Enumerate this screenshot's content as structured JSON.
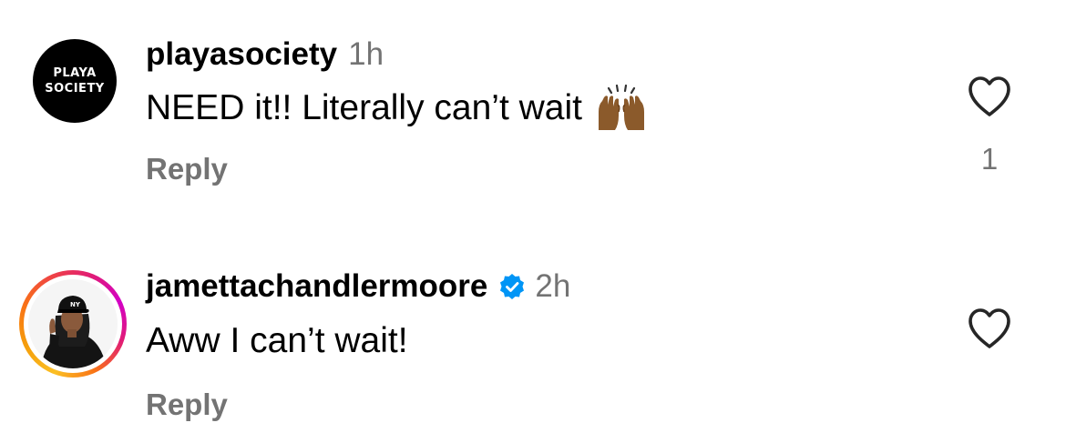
{
  "comments": [
    {
      "username": "playasociety",
      "timestamp": "1h",
      "avatar_text_line1": "PLAYA",
      "avatar_text_line2": "SOCIETY",
      "text": "NEED it!! Literally can’t wait",
      "emoji_icon": "raising-hands-emoji",
      "reply_label": "Reply",
      "like_count": "1",
      "verified": false
    },
    {
      "username": "jamettachandlermoore",
      "timestamp": "2h",
      "text": "Aww I can’t wait!",
      "reply_label": "Reply",
      "verified": true,
      "verified_color": "#0095f6"
    }
  ],
  "colors": {
    "secondary_text": "#737373",
    "verified_badge": "#0095f6"
  }
}
